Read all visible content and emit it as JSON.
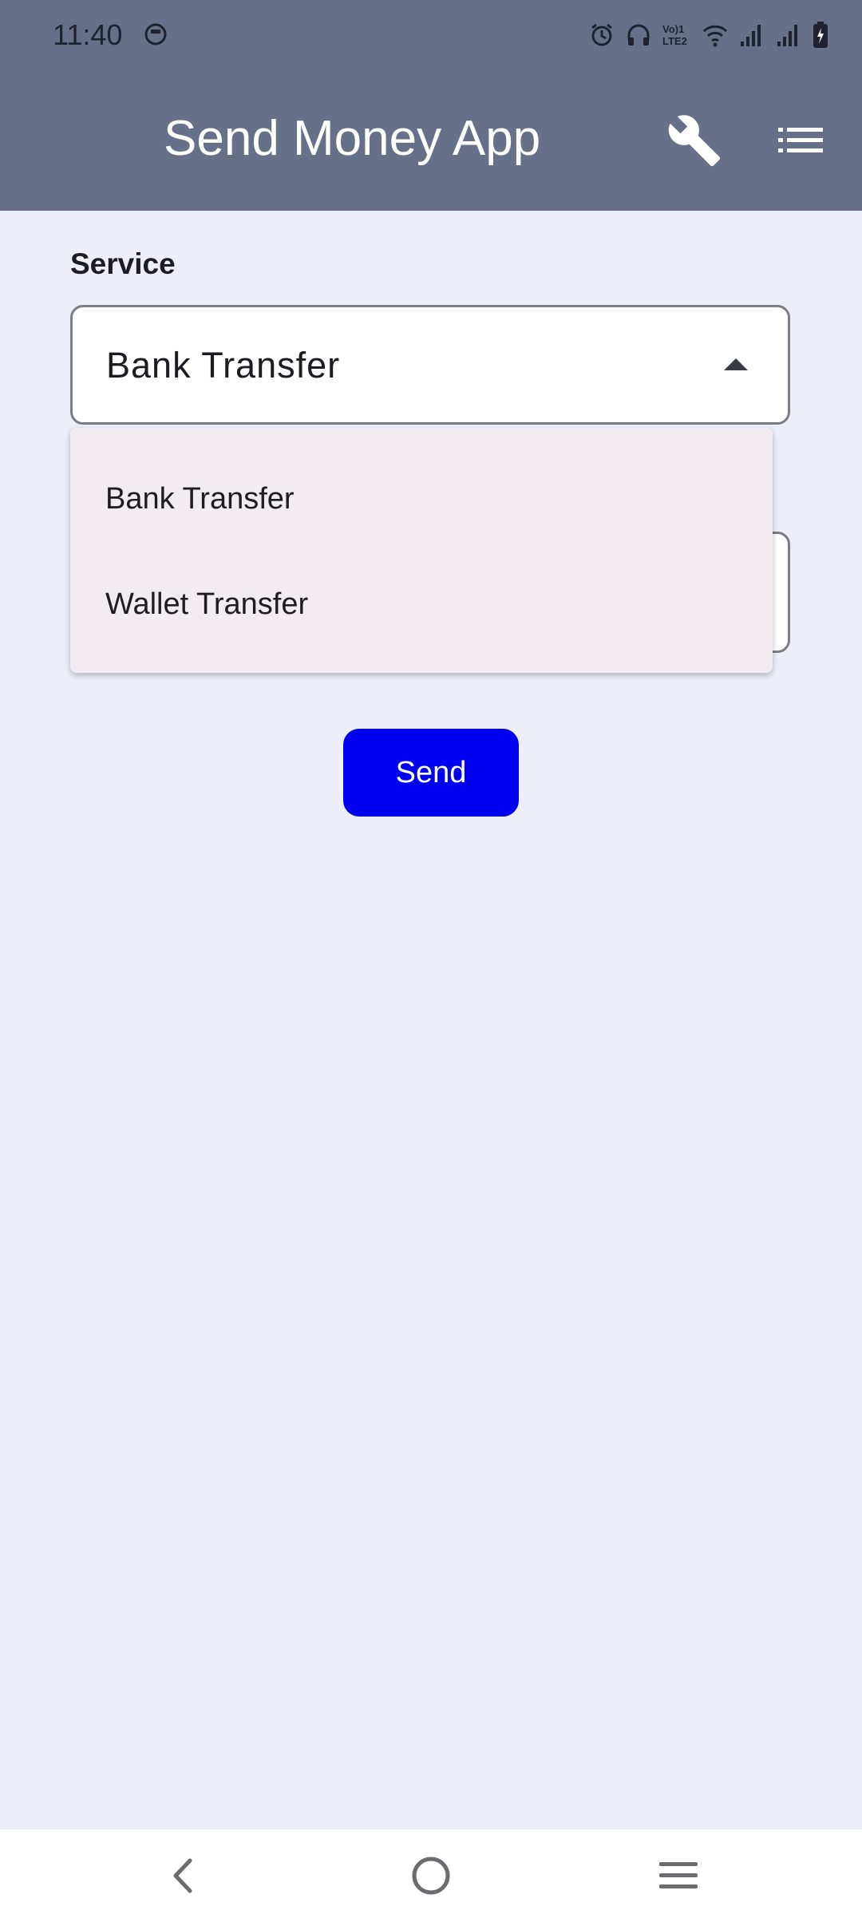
{
  "status_bar": {
    "time": "11:40",
    "left_icon": "app-notification-icon",
    "right_icons": [
      "alarm-icon",
      "headphones-icon",
      "volte-icon",
      "wifi-icon",
      "signal-icon",
      "signal-icon",
      "battery-charging-icon"
    ],
    "volte_text": "Vo) LTE2"
  },
  "app_bar": {
    "title": "Send Money App",
    "actions": [
      "wrench-icon",
      "list-menu-icon"
    ],
    "background_color": "#667089"
  },
  "form": {
    "service_label": "Service",
    "service_value": "Bank Transfer",
    "dropdown_options": [
      "Bank Transfer",
      "Wallet Transfer"
    ],
    "send_label": "Send",
    "send_color": "#0000f0"
  },
  "nav_bar": {
    "buttons": [
      "back-icon",
      "home-icon",
      "recents-icon"
    ]
  }
}
